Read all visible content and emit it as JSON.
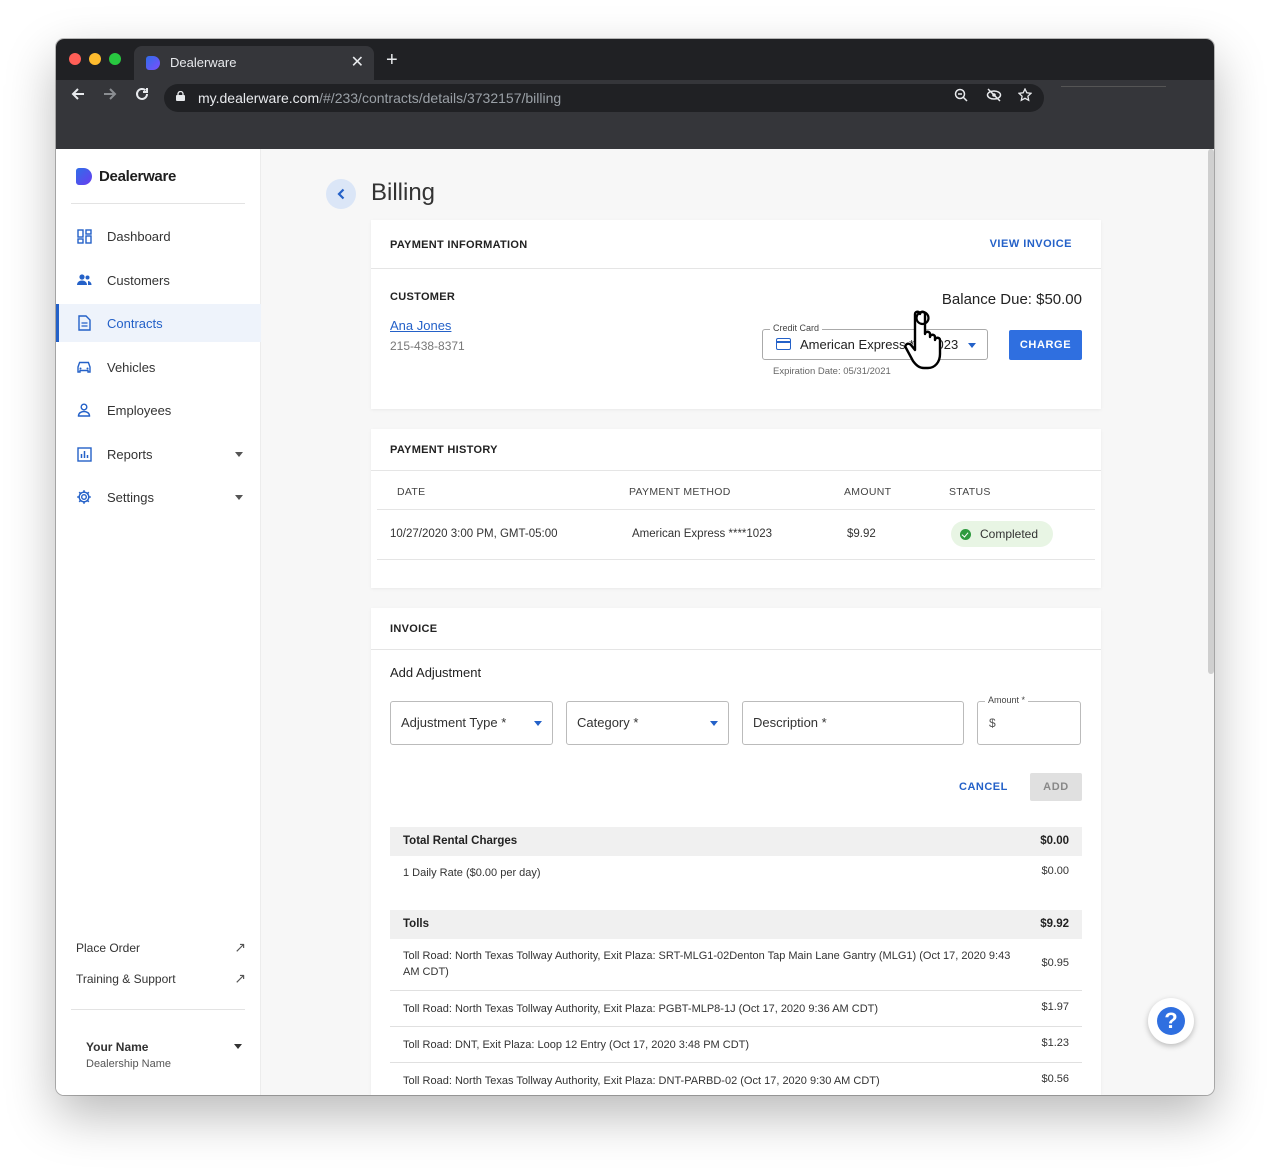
{
  "browser": {
    "tab_title": "Dealerware",
    "url_host": "my.dealerware.com",
    "url_path": "/#/233/contracts/details/3732157/billing",
    "tab_close": "✕",
    "new_tab": "+"
  },
  "sidebar": {
    "brand": "Dealerware",
    "items": [
      {
        "label": "Dashboard",
        "icon": "dashboard-icon"
      },
      {
        "label": "Customers",
        "icon": "people-icon"
      },
      {
        "label": "Contracts",
        "icon": "document-icon",
        "active": true
      },
      {
        "label": "Vehicles",
        "icon": "car-icon"
      },
      {
        "label": "Employees",
        "icon": "person-icon"
      },
      {
        "label": "Reports",
        "icon": "bar-chart-icon",
        "has_caret": true
      },
      {
        "label": "Settings",
        "icon": "gear-icon",
        "has_caret": true
      }
    ],
    "footer_links": [
      {
        "label": "Place Order",
        "icon": "external-arrow-icon"
      },
      {
        "label": "Training & Support",
        "icon": "external-arrow-icon"
      }
    ],
    "user_name": "Your Name",
    "dealership_name": "Dealership Name"
  },
  "page": {
    "title": "Billing"
  },
  "payment_info": {
    "title": "PAYMENT INFORMATION",
    "view_invoice": "VIEW INVOICE",
    "customer_label": "CUSTOMER",
    "customer_name": "Ana Jones",
    "customer_phone": "215-438-8371",
    "balance_due": "Balance Due: $50.00",
    "credit_card_label": "Credit Card",
    "credit_card_value": "American Express ****1023",
    "expiration": "Expiration Date: 05/31/2021",
    "charge_button": "CHARGE"
  },
  "payment_history": {
    "title": "PAYMENT HISTORY",
    "columns": [
      "DATE",
      "PAYMENT METHOD",
      "AMOUNT",
      "STATUS"
    ],
    "rows": [
      {
        "date": "10/27/2020 3:00 PM, GMT-05:00",
        "method": "American Express ****1023",
        "amount": "$9.92",
        "status": "Completed"
      }
    ],
    "status_color": "#2e9a3e"
  },
  "invoice": {
    "title": "INVOICE",
    "add_adjustment": "Add Adjustment",
    "adjustment_type": "Adjustment Type *",
    "category": "Category *",
    "description": "Description *",
    "amount_label": "Amount *",
    "amount_prefix": "$",
    "cancel": "CANCEL",
    "add": "ADD",
    "sections": [
      {
        "label": "Total Rental Charges",
        "amount": "$0.00",
        "rows": [
          {
            "label": "1 Daily Rate ($0.00 per day)",
            "amount": "$0.00"
          }
        ]
      },
      {
        "label": "Tolls",
        "amount": "$9.92",
        "rows": [
          {
            "label": "Toll Road: North Texas Tollway Authority, Exit Plaza: SRT-MLG1-02Denton Tap Main Lane Gantry (MLG1) (Oct 17, 2020 9:43 AM CDT)",
            "amount": "$0.95"
          },
          {
            "label": "Toll Road: North Texas Tollway Authority, Exit Plaza: PGBT-MLP8-1J (Oct 17, 2020 9:36 AM CDT)",
            "amount": "$1.97"
          },
          {
            "label": "Toll Road: DNT, Exit Plaza: Loop 12 Entry (Oct 17, 2020 3:48 PM CDT)",
            "amount": "$1.23"
          },
          {
            "label": "Toll Road: North Texas Tollway Authority, Exit Plaza: DNT-PARBD-02 (Oct 17, 2020 9:30 AM CDT)",
            "amount": "$0.56"
          }
        ]
      }
    ]
  },
  "help_button": "?",
  "colors": {
    "accent": "#2461c8",
    "primary_button": "#2f6fe0",
    "chrome_dark": "#202124",
    "chrome_toolbar": "#35363a"
  }
}
